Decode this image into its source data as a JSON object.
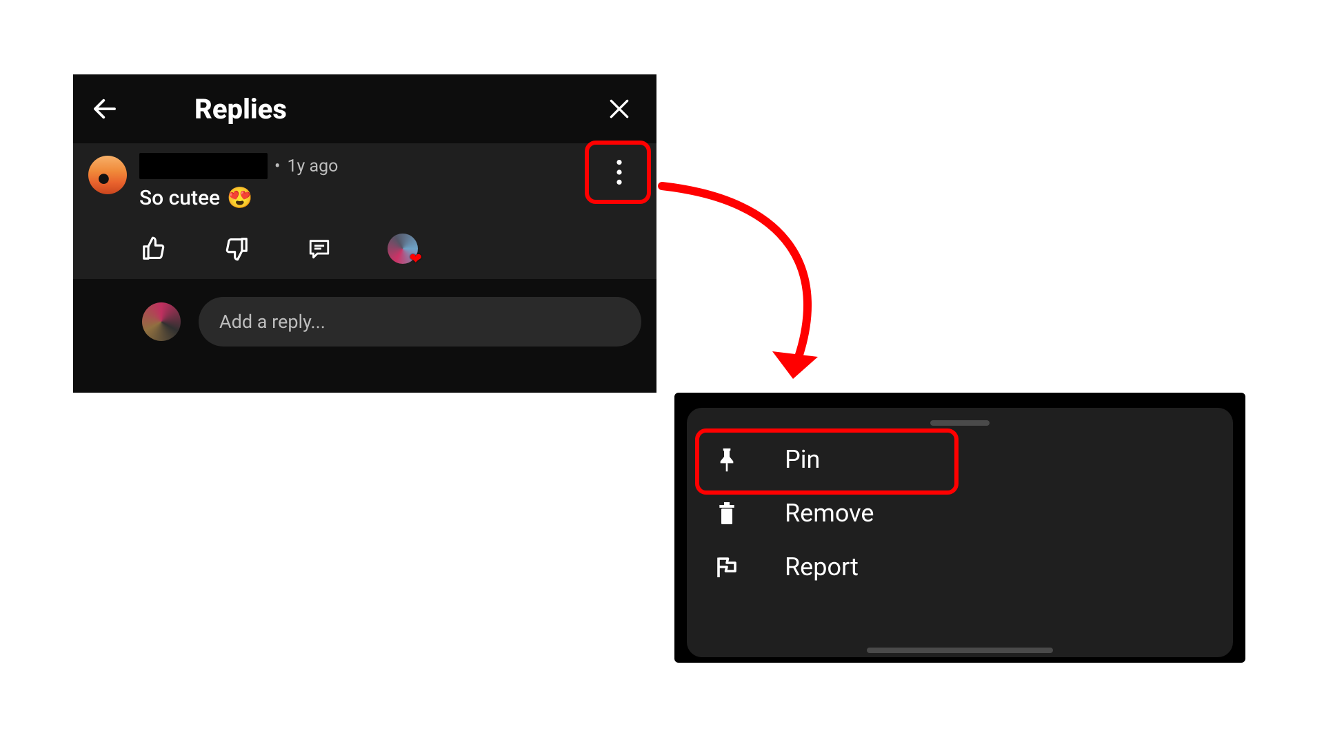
{
  "header": {
    "title": "Replies"
  },
  "comment": {
    "timestamp": "1y ago",
    "text": "So cutee",
    "emoji": "😍"
  },
  "reply_input": {
    "placeholder": "Add a reply..."
  },
  "menu": {
    "items": [
      {
        "label": "Pin",
        "icon": "pin-icon"
      },
      {
        "label": "Remove",
        "icon": "trash-icon"
      },
      {
        "label": "Report",
        "icon": "flag-icon"
      }
    ]
  },
  "annotations": {
    "highlight_color": "#ff0000"
  }
}
